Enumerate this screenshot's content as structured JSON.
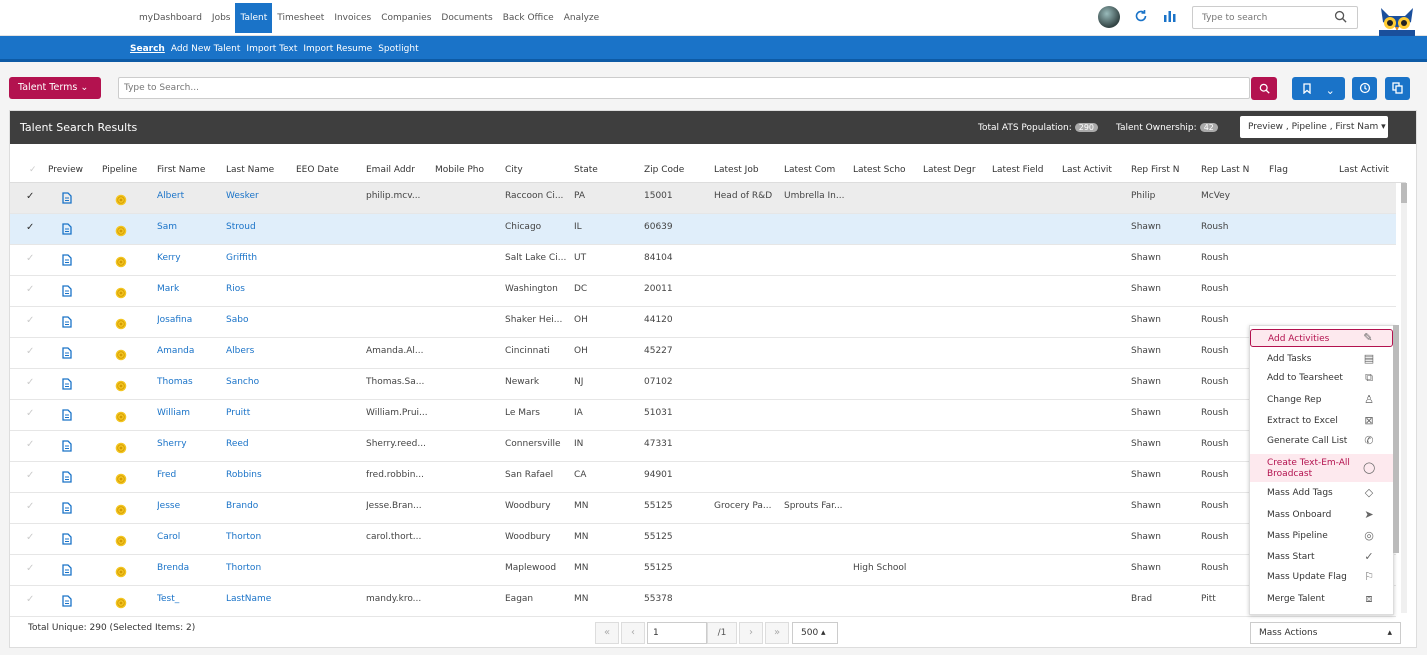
{
  "topnav": {
    "tabs": [
      "myDashboard",
      "Jobs",
      "Talent",
      "Timesheet",
      "Invoices",
      "Companies",
      "Documents",
      "Back Office",
      "Analyze"
    ],
    "active_tab": "Talent",
    "search_placeholder": "Type to search",
    "accent": "#1a73c8"
  },
  "subnav": {
    "items": [
      "Search",
      "Add New Talent",
      "Import Text",
      "Import Resume",
      "Spotlight"
    ],
    "active": "Search"
  },
  "searchbar": {
    "terms_label": "Talent Terms",
    "placeholder": "Type to Search...",
    "brand_color": "#b3124f"
  },
  "panel": {
    "title": "Talent Search Results",
    "ats_label": "Total ATS Population:",
    "ats_count": "290",
    "ownership_label": "Talent Ownership:",
    "ownership_count": "42",
    "column_selector": "Preview , Pipeline , First Nam"
  },
  "table": {
    "columns": [
      "Preview",
      "Pipeline",
      "First Name",
      "Last Name",
      "EEO Date",
      "Email Addr",
      "Mobile Pho",
      "City",
      "State",
      "Zip Code",
      "Latest Job",
      "Latest Com",
      "Latest Scho",
      "Latest Degr",
      "Latest Field",
      "Last Activit",
      "Rep First N",
      "Rep Last N",
      "Flag",
      "Last Activit"
    ],
    "rows": [
      {
        "selected": true,
        "first": "Albert",
        "last": "Wesker",
        "email": "philip.mcv...",
        "city": "Raccoon Ci...",
        "state": "PA",
        "zip": "15001",
        "job": "Head of R&D",
        "company": "Umbrella In...",
        "school": "",
        "rep_first": "Philip",
        "rep_last": "McVey"
      },
      {
        "selected": true,
        "first": "Sam",
        "last": "Stroud",
        "email": "",
        "city": "Chicago",
        "state": "IL",
        "zip": "60639",
        "job": "",
        "company": "",
        "school": "",
        "rep_first": "Shawn",
        "rep_last": "Roush"
      },
      {
        "selected": false,
        "first": "Kerry",
        "last": "Griffith",
        "email": "",
        "city": "Salt Lake Ci...",
        "state": "UT",
        "zip": "84104",
        "job": "",
        "company": "",
        "school": "",
        "rep_first": "Shawn",
        "rep_last": "Roush"
      },
      {
        "selected": false,
        "first": "Mark",
        "last": "Rios",
        "email": "",
        "city": "Washington",
        "state": "DC",
        "zip": "20011",
        "job": "",
        "company": "",
        "school": "",
        "rep_first": "Shawn",
        "rep_last": "Roush"
      },
      {
        "selected": false,
        "first": "Josafina",
        "last": "Sabo",
        "email": "",
        "city": "Shaker Hei...",
        "state": "OH",
        "zip": "44120",
        "job": "",
        "company": "",
        "school": "",
        "rep_first": "Shawn",
        "rep_last": "Roush"
      },
      {
        "selected": false,
        "first": "Amanda",
        "last": "Albers",
        "email": "Amanda.Al...",
        "city": "Cincinnati",
        "state": "OH",
        "zip": "45227",
        "job": "",
        "company": "",
        "school": "",
        "rep_first": "Shawn",
        "rep_last": "Roush"
      },
      {
        "selected": false,
        "first": "Thomas",
        "last": "Sancho",
        "email": "Thomas.Sa...",
        "city": "Newark",
        "state": "NJ",
        "zip": "07102",
        "job": "",
        "company": "",
        "school": "",
        "rep_first": "Shawn",
        "rep_last": "Roush"
      },
      {
        "selected": false,
        "first": "William",
        "last": "Pruitt",
        "email": "William.Prui...",
        "city": "Le Mars",
        "state": "IA",
        "zip": "51031",
        "job": "",
        "company": "",
        "school": "",
        "rep_first": "Shawn",
        "rep_last": "Roush"
      },
      {
        "selected": false,
        "first": "Sherry",
        "last": "Reed",
        "email": "Sherry.reed...",
        "city": "Connersville",
        "state": "IN",
        "zip": "47331",
        "job": "",
        "company": "",
        "school": "",
        "rep_first": "Shawn",
        "rep_last": "Roush"
      },
      {
        "selected": false,
        "first": "Fred",
        "last": "Robbins",
        "email": "fred.robbin...",
        "city": "San Rafael",
        "state": "CA",
        "zip": "94901",
        "job": "",
        "company": "",
        "school": "",
        "rep_first": "Shawn",
        "rep_last": "Roush"
      },
      {
        "selected": false,
        "first": "Jesse",
        "last": "Brando",
        "email": "Jesse.Bran...",
        "city": "Woodbury",
        "state": "MN",
        "zip": "55125",
        "job": "Grocery Pa...",
        "company": "Sprouts Far...",
        "school": "",
        "rep_first": "Shawn",
        "rep_last": "Roush"
      },
      {
        "selected": false,
        "first": "Carol",
        "last": "Thorton",
        "email": "carol.thort...",
        "city": "Woodbury",
        "state": "MN",
        "zip": "55125",
        "job": "",
        "company": "",
        "school": "",
        "rep_first": "Shawn",
        "rep_last": "Roush"
      },
      {
        "selected": false,
        "first": "Brenda",
        "last": "Thorton",
        "email": "",
        "city": "Maplewood",
        "state": "MN",
        "zip": "55125",
        "job": "",
        "company": "",
        "school": "High School",
        "rep_first": "Shawn",
        "rep_last": "Roush"
      },
      {
        "selected": false,
        "first": "Test_",
        "last": "LastName",
        "email": "mandy.kro...",
        "city": "Eagan",
        "state": "MN",
        "zip": "55378",
        "job": "",
        "company": "",
        "school": "",
        "rep_first": "Brad",
        "rep_last": "Pitt"
      }
    ]
  },
  "footer": {
    "total_unique": "Total Unique: 290 (Selected Items: 2)",
    "page": "1",
    "page_of": "/1",
    "page_size": "500 ▴",
    "mass_actions": "Mass Actions"
  },
  "mass_menu": [
    {
      "label": "Add Activities",
      "icon": "pencil-icon"
    },
    {
      "label": "Add Tasks",
      "icon": "clipboard-icon"
    },
    {
      "label": "Add to Tearsheet",
      "icon": "copy-icon"
    },
    {
      "label": "Change Rep",
      "icon": "person-icon"
    },
    {
      "label": "Extract to Excel",
      "icon": "excel-icon"
    },
    {
      "label": "Generate Call List",
      "icon": "phone-icon"
    },
    {
      "label": "Create Text-Em-All Broadcast",
      "icon": "chat-icon"
    },
    {
      "label": "Mass Add Tags",
      "icon": "tag-icon"
    },
    {
      "label": "Mass Onboard",
      "icon": "send-icon"
    },
    {
      "label": "Mass Pipeline",
      "icon": "target-icon"
    },
    {
      "label": "Mass Start",
      "icon": "check-icon"
    },
    {
      "label": "Mass Update Flag",
      "icon": "flag-icon"
    },
    {
      "label": "Merge Talent",
      "icon": "merge-icon"
    }
  ]
}
